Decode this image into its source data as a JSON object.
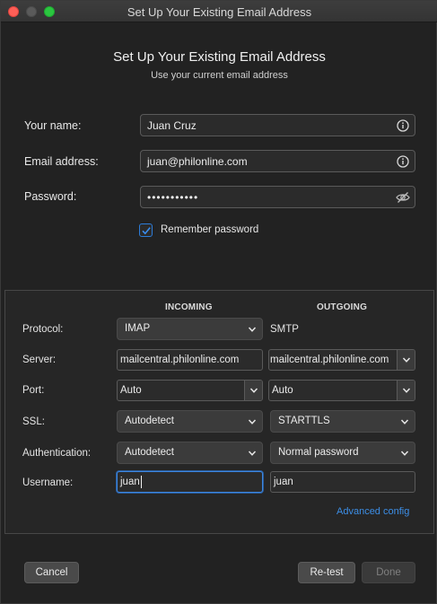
{
  "window": {
    "title": "Set Up Your Existing Email Address"
  },
  "header": {
    "title": "Set Up Your Existing Email Address",
    "subtitle": "Use your current email address"
  },
  "account": {
    "name_label": "Your name:",
    "name_value": "Juan Cruz",
    "email_label": "Email address:",
    "email_value": "juan@philonline.com",
    "password_label": "Password:",
    "password_value": "•••••••••••",
    "remember_label": "Remember password",
    "remember_checked": true
  },
  "server_config": {
    "incoming_header": "INCOMING",
    "outgoing_header": "OUTGOING",
    "protocol": {
      "label": "Protocol:",
      "incoming": "IMAP",
      "outgoing": "SMTP"
    },
    "server": {
      "label": "Server:",
      "incoming": "mailcentral.philonline.com",
      "outgoing": "mailcentral.philonline.com"
    },
    "port": {
      "label": "Port:",
      "incoming": "Auto",
      "outgoing": "Auto"
    },
    "ssl": {
      "label": "SSL:",
      "incoming": "Autodetect",
      "outgoing": "STARTTLS"
    },
    "authentication": {
      "label": "Authentication:",
      "incoming": "Autodetect",
      "outgoing": "Normal password"
    },
    "username": {
      "label": "Username:",
      "incoming": "juan",
      "outgoing": "juan"
    },
    "advanced_link": "Advanced config"
  },
  "footer": {
    "cancel": "Cancel",
    "retest": "Re-test",
    "done": "Done"
  },
  "colors": {
    "accent": "#3c8ee6",
    "close": "#fd5f57",
    "maximize": "#2bc640"
  }
}
